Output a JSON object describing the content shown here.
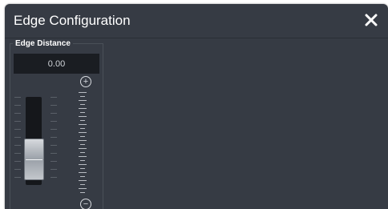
{
  "dialog": {
    "title": "Edge Configuration"
  },
  "edge_distance": {
    "label": "Edge Distance",
    "value": "0.00",
    "slider_level": 0
  },
  "icons": {
    "close": "close-icon",
    "increase": "plus-circle-icon",
    "decrease": "minus-circle-icon"
  },
  "colors": {
    "window_bg": "#363b44",
    "display_bg": "#1a1d22",
    "text": "#ffffff"
  }
}
